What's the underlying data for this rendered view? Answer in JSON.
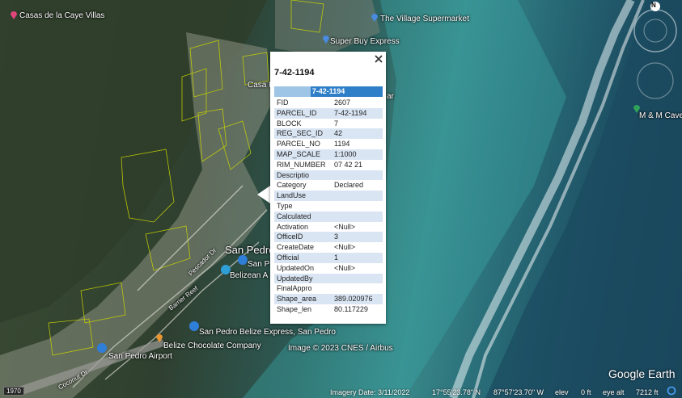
{
  "map": {
    "labels": {
      "casas": "Casas de la Caye Villas",
      "village": "The Village Supermarket",
      "superbuy": "Super Buy Express",
      "casa_partial": "Casa P",
      "bar_partial": "ar",
      "mm_cave": "M & M Cave",
      "san_pedro": "San Pedro",
      "san_pedro_2": "San P",
      "belizean": "Belizean A",
      "express": "San Pedro Belize Express, San Pedro",
      "chocolate": "Belize Chocolate Company",
      "airport": "San Pedro Airport",
      "image_credit": "Image © 2023 CNES / Airbus",
      "street1": "Pescador Dr",
      "street2": "Barrier Reef",
      "street3": "Coconut Dr",
      "year_badge": "1970"
    },
    "colors": {
      "popup_header": "#2f7fc8",
      "row_alt": "#d9e5f3",
      "parcel_outline": "#c8d400"
    }
  },
  "popup": {
    "title": "7-42-1194",
    "header": "7-42-1194",
    "close_icon": "close-icon",
    "rows": [
      {
        "key": "FID",
        "value": "2607"
      },
      {
        "key": "PARCEL_ID",
        "value": "7-42-1194"
      },
      {
        "key": "BLOCK",
        "value": "7"
      },
      {
        "key": "REG_SEC_ID",
        "value": "42"
      },
      {
        "key": "PARCEL_NO",
        "value": "1194"
      },
      {
        "key": "MAP_SCALE",
        "value": "1:1000"
      },
      {
        "key": "RIM_NUMBER",
        "value": "07 42 21"
      },
      {
        "key": "Descriptio",
        "value": ""
      },
      {
        "key": "Category",
        "value": "Declared"
      },
      {
        "key": "LandUse",
        "value": ""
      },
      {
        "key": "Type",
        "value": ""
      },
      {
        "key": "Calculated",
        "value": ""
      },
      {
        "key": "Activation",
        "value": "<Null>"
      },
      {
        "key": "OfficeID",
        "value": "3"
      },
      {
        "key": "CreateDate",
        "value": "<Null>"
      },
      {
        "key": "Official",
        "value": "1"
      },
      {
        "key": "UpdatedOn",
        "value": "<Null>"
      },
      {
        "key": "UpdatedBy",
        "value": ""
      },
      {
        "key": "FinalAppro",
        "value": ""
      },
      {
        "key": "Shape_area",
        "value": "389.020976"
      },
      {
        "key": "Shape_len",
        "value": "80.117229"
      }
    ]
  },
  "status": {
    "imagery_date": "Imagery Date: 3/11/2022",
    "lat": "17°55'23.78\" N",
    "lon": "87°57'23.70\" W",
    "elev_label": "elev",
    "elev_value": "0 ft",
    "eye_alt": "eye alt",
    "eye_alt_value": "7212 ft"
  },
  "brand": "Google Earth",
  "compass_north": "N"
}
